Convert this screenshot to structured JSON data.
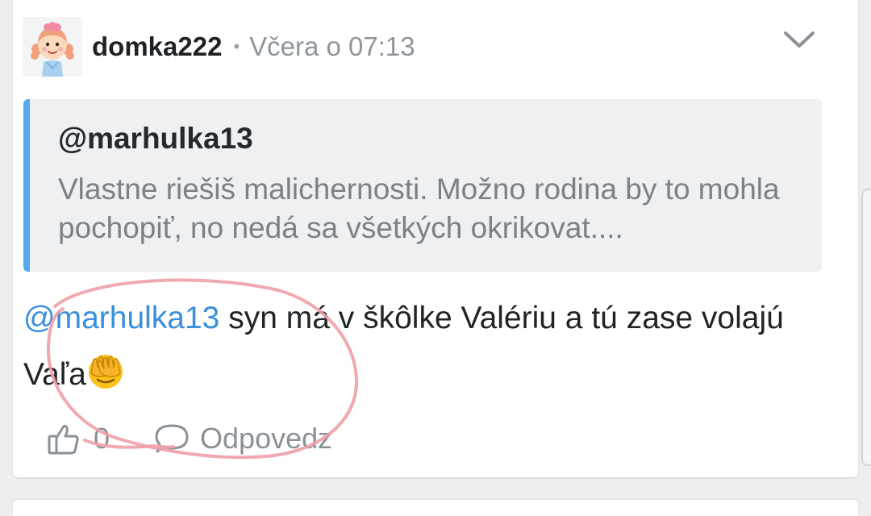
{
  "post": {
    "username": "domka222",
    "separator": "•",
    "timestamp": "Včera o 07:13",
    "avatar_icon": "girl-avatar-icon",
    "menu_icon": "chevron-down-icon"
  },
  "quote": {
    "author": "@marhulka13",
    "text": "Vlastne riešiš malichernosti. Možno rodina by to mohla pochopiť, no nedá sa všetkých okrikovat....",
    "accent_color": "#55a8f2"
  },
  "comment": {
    "mention": "@marhulka13",
    "text": " syn má v škôlke Valériu a tú zase volajú Vaľa",
    "emoji": "face-with-hand-over-eyes"
  },
  "actions": {
    "like_icon": "thumbs-up-icon",
    "like_count": "0",
    "reply_icon": "speech-bubble-icon",
    "reply_label": "Odpovedz"
  },
  "overlay": {
    "annotation": "hand-drawn-pink-circle",
    "color": "#f0a0a8"
  }
}
